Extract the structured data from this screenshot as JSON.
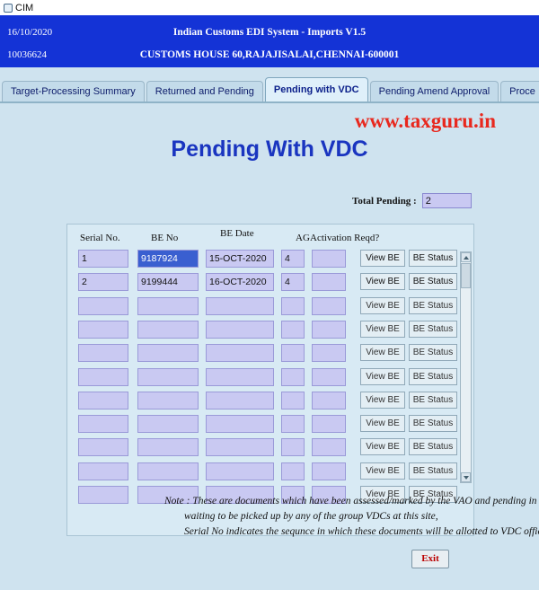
{
  "window": {
    "title": "CIM",
    "icon": "window-icon"
  },
  "header": {
    "date": "16/10/2020",
    "code": "10036624",
    "title_line1": "Indian Customs EDI System - Imports V1.5",
    "title_line2": "CUSTOMS HOUSE 60,RAJAJISALAI,CHENNAI-600001"
  },
  "tabs": [
    {
      "label": "Target-Processing Summary",
      "active": false
    },
    {
      "label": "Returned and Pending",
      "active": false
    },
    {
      "label": "Pending with VDC",
      "active": true
    },
    {
      "label": "Pending Amend Approval",
      "active": false
    },
    {
      "label": "Proce",
      "active": false
    }
  ],
  "watermark": "www.taxguru.in",
  "page": {
    "title": "Pending With VDC",
    "total_pending_label": "Total Pending :",
    "total_pending_value": "2"
  },
  "grid": {
    "columns": [
      "Serial No.",
      "BE No",
      "BE Date",
      "AG",
      "Activation Reqd?"
    ],
    "rows": [
      {
        "serial": "1",
        "be_no": "9187924",
        "be_date": "15-OCT-2020",
        "ag": "4",
        "activation": "",
        "view": "View BE",
        "status": "BE Status",
        "enabled": true,
        "selected": true
      },
      {
        "serial": "2",
        "be_no": "9199444",
        "be_date": "16-OCT-2020",
        "ag": "4",
        "activation": "",
        "view": "View BE",
        "status": "BE Status",
        "enabled": true,
        "selected": false
      },
      {
        "serial": "",
        "be_no": "",
        "be_date": "",
        "ag": "",
        "activation": "",
        "view": "View BE",
        "status": "BE Status",
        "enabled": false,
        "selected": false
      },
      {
        "serial": "",
        "be_no": "",
        "be_date": "",
        "ag": "",
        "activation": "",
        "view": "View BE",
        "status": "BE Status",
        "enabled": false,
        "selected": false
      },
      {
        "serial": "",
        "be_no": "",
        "be_date": "",
        "ag": "",
        "activation": "",
        "view": "View BE",
        "status": "BE Status",
        "enabled": false,
        "selected": false
      },
      {
        "serial": "",
        "be_no": "",
        "be_date": "",
        "ag": "",
        "activation": "",
        "view": "View BE",
        "status": "BE Status",
        "enabled": false,
        "selected": false
      },
      {
        "serial": "",
        "be_no": "",
        "be_date": "",
        "ag": "",
        "activation": "",
        "view": "View BE",
        "status": "BE Status",
        "enabled": false,
        "selected": false
      },
      {
        "serial": "",
        "be_no": "",
        "be_date": "",
        "ag": "",
        "activation": "",
        "view": "View BE",
        "status": "BE Status",
        "enabled": false,
        "selected": false
      },
      {
        "serial": "",
        "be_no": "",
        "be_date": "",
        "ag": "",
        "activation": "",
        "view": "View BE",
        "status": "BE Status",
        "enabled": false,
        "selected": false
      },
      {
        "serial": "",
        "be_no": "",
        "be_date": "",
        "ag": "",
        "activation": "",
        "view": "View BE",
        "status": "BE Status",
        "enabled": false,
        "selected": false
      },
      {
        "serial": "",
        "be_no": "",
        "be_date": "",
        "ag": "",
        "activation": "",
        "view": "View BE",
        "status": "BE Status",
        "enabled": false,
        "selected": false
      }
    ]
  },
  "note": {
    "line1": "Note : These are documents which have been assessed/marked by the VAO and pending in VDC queue,",
    "line2": "waiting to be picked up by any of the group VDCs at this site,",
    "line3": "Serial No indicates the sequnce in which these documents will be  allotted to VDC officer(s)."
  },
  "footer": {
    "exit_label": "Exit"
  },
  "colors": {
    "header_blue": "#1433d6",
    "body_bg": "#cfe3ef",
    "field_bg": "#c9c9f2",
    "title_blue": "#1a35c0",
    "watermark_red": "#e8281e",
    "selection_blue": "#3a5fd0"
  }
}
